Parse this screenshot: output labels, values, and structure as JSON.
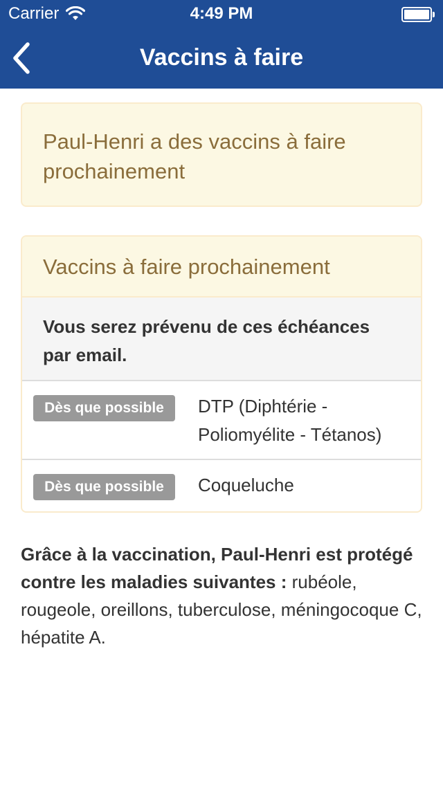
{
  "status_bar": {
    "carrier": "Carrier",
    "time": "4:49 PM",
    "battery_level": 1.0
  },
  "nav": {
    "title": "Vaccins à faire",
    "back_icon": "chevron-left-icon"
  },
  "alert": {
    "text": "Paul-Henri a des vaccins à faire prochainement"
  },
  "panel": {
    "heading": "Vaccins à faire prochainement",
    "note": "Vous serez prévenu de ces échéances par email.",
    "items": [
      {
        "badge": "Dès que possible",
        "vaccine": "DTP (Diphtérie - Poliomyélite - Tétanos)"
      },
      {
        "badge": "Dès que possible",
        "vaccine": "Coqueluche"
      }
    ]
  },
  "summary": {
    "bold": "Grâce à la vaccination, Paul-Henri est protégé contre les maladies suivantes :",
    "list": "rubéole, rougeole, oreillons, tuberculose, méningocoque C, hépatite A."
  },
  "colors": {
    "nav_background": "#1f4d96",
    "warning_background": "#fcf8e3",
    "warning_text": "#8a6d3b",
    "warning_border": "#faebcc",
    "badge_background": "#999999"
  }
}
